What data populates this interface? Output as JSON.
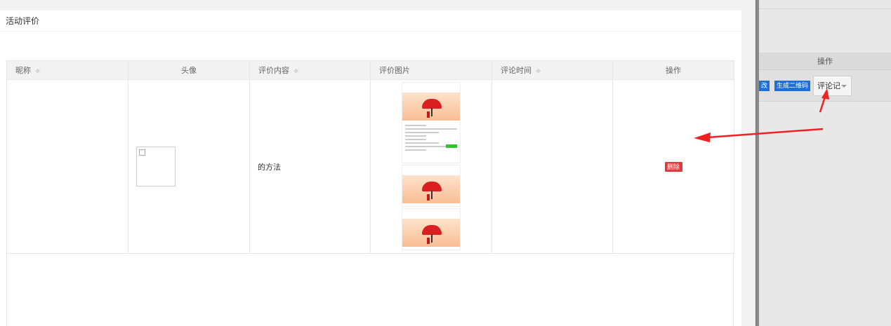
{
  "modal": {
    "title": "活动评价"
  },
  "table": {
    "columns": [
      {
        "label": "昵称",
        "sortable": true
      },
      {
        "label": "头像",
        "sortable": false
      },
      {
        "label": "评价内容",
        "sortable": true
      },
      {
        "label": "评价图片",
        "sortable": false
      },
      {
        "label": "评论时间",
        "sortable": true
      },
      {
        "label": "操作",
        "sortable": false
      }
    ],
    "rows": [
      {
        "nickname": "",
        "content": "的方法",
        "comment_time": "",
        "delete_label": "删除"
      }
    ]
  },
  "background_panel": {
    "column_header": "操作",
    "edit_label": "改",
    "qr_label": "生成二维码",
    "select_value": "评论记"
  },
  "colors": {
    "delete": "#e4393c",
    "blue_button": "#1e6fd9",
    "arrow": "#ee2222",
    "header_bg": "#f2f2f2"
  },
  "icons": {
    "sort": "sort-icon",
    "broken_image": "broken-image-icon",
    "caret": "chevron-down-icon"
  }
}
